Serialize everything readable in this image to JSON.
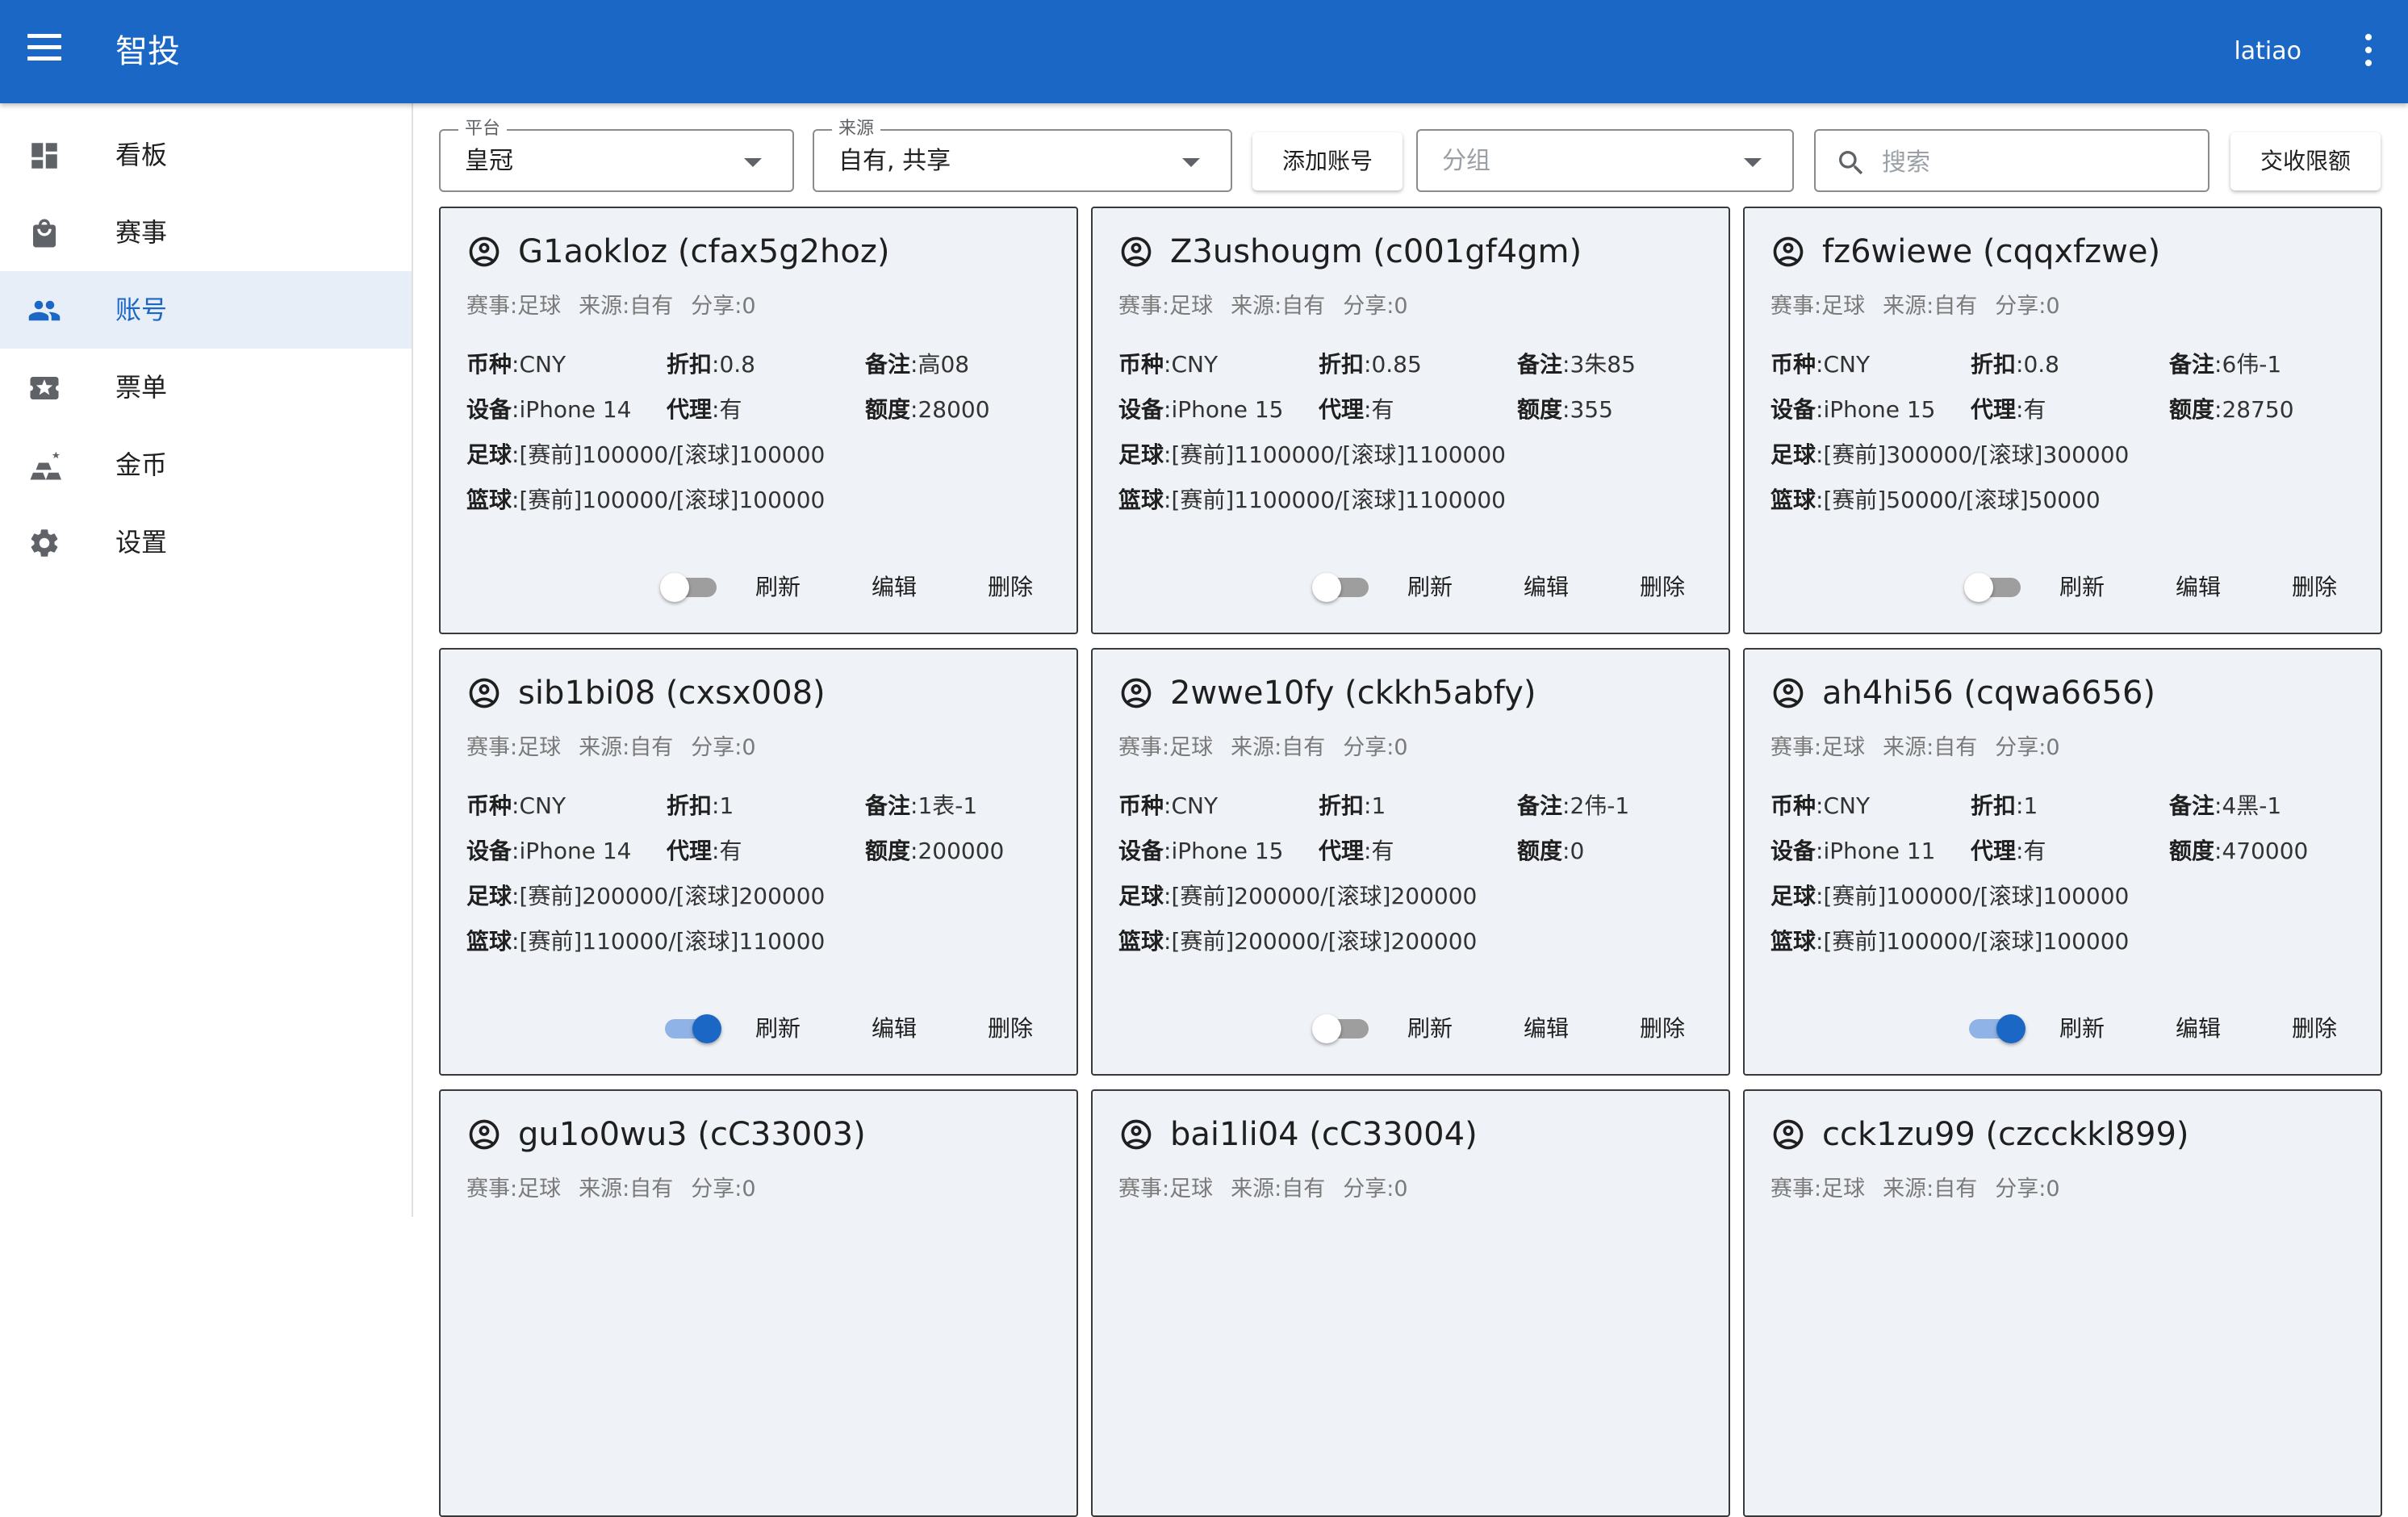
{
  "app": {
    "title": "智投",
    "user": "latiao"
  },
  "sidebar": {
    "items": [
      {
        "label": "看板",
        "icon": "dashboard-icon"
      },
      {
        "label": "赛事",
        "icon": "shopping-bag-icon"
      },
      {
        "label": "账号",
        "icon": "people-icon",
        "active": true
      },
      {
        "label": "票单",
        "icon": "ticket-icon"
      },
      {
        "label": "金币",
        "icon": "gold-bars-icon"
      },
      {
        "label": "设置",
        "icon": "gear-icon"
      }
    ]
  },
  "filters": {
    "platform": {
      "label": "平台",
      "value": "皇冠"
    },
    "source": {
      "label": "来源",
      "value": "自有, 共享"
    },
    "add_button": "添加账号",
    "group": {
      "placeholder": "分组"
    },
    "search": {
      "placeholder": "搜索"
    },
    "limit_button": "交收限额"
  },
  "labels": {
    "match": "赛事",
    "source": "来源",
    "share": "分享",
    "currency": "币种",
    "discount": "折扣",
    "note": "备注",
    "device": "设备",
    "proxy": "代理",
    "amount": "额度",
    "football": "足球",
    "basketball": "篮球",
    "refresh": "刷新",
    "edit": "编辑",
    "delete": "删除"
  },
  "accounts": [
    {
      "title": "G1aokloz (cfax5g2hoz)",
      "match": "足球",
      "source": "自有",
      "share": "0",
      "currency": "CNY",
      "discount": "0.8",
      "note": "高08",
      "device": "iPhone 14",
      "proxy": "有",
      "amount": "28000",
      "football": "[赛前]100000/[滚球]100000",
      "basketball": "[赛前]100000/[滚球]100000",
      "enabled": false
    },
    {
      "title": "Z3ushougm (c001gf4gm)",
      "match": "足球",
      "source": "自有",
      "share": "0",
      "currency": "CNY",
      "discount": "0.85",
      "note": "3朱85",
      "device": "iPhone 15",
      "proxy": "有",
      "amount": "355",
      "football": "[赛前]1100000/[滚球]1100000",
      "basketball": "[赛前]1100000/[滚球]1100000",
      "enabled": false
    },
    {
      "title": "fz6wiewe (cqqxfzwe)",
      "match": "足球",
      "source": "自有",
      "share": "0",
      "currency": "CNY",
      "discount": "0.8",
      "note": "6伟-1",
      "device": "iPhone 15",
      "proxy": "有",
      "amount": "28750",
      "football": "[赛前]300000/[滚球]300000",
      "basketball": "[赛前]50000/[滚球]50000",
      "enabled": false
    },
    {
      "title": "sib1bi08 (cxsx008)",
      "match": "足球",
      "source": "自有",
      "share": "0",
      "currency": "CNY",
      "discount": "1",
      "note": "1表-1",
      "device": "iPhone 14",
      "proxy": "有",
      "amount": "200000",
      "football": "[赛前]200000/[滚球]200000",
      "basketball": "[赛前]110000/[滚球]110000",
      "enabled": true
    },
    {
      "title": "2wwe10fy (ckkh5abfy)",
      "match": "足球",
      "source": "自有",
      "share": "0",
      "currency": "CNY",
      "discount": "1",
      "note": "2伟-1",
      "device": "iPhone 15",
      "proxy": "有",
      "amount": "0",
      "football": "[赛前]200000/[滚球]200000",
      "basketball": "[赛前]200000/[滚球]200000",
      "enabled": false
    },
    {
      "title": "ah4hi56 (cqwa6656)",
      "match": "足球",
      "source": "自有",
      "share": "0",
      "currency": "CNY",
      "discount": "1",
      "note": "4黑-1",
      "device": "iPhone 11",
      "proxy": "有",
      "amount": "470000",
      "football": "[赛前]100000/[滚球]100000",
      "basketball": "[赛前]100000/[滚球]100000",
      "enabled": true
    },
    {
      "title": "gu1o0wu3 (cC33003)",
      "match": "足球",
      "source": "自有",
      "share": "0"
    },
    {
      "title": "bai1li04 (cC33004)",
      "match": "足球",
      "source": "自有",
      "share": "0"
    },
    {
      "title": "cck1zu99 (czcckkl899)",
      "match": "足球",
      "source": "自有",
      "share": "0"
    }
  ],
  "colors": {
    "primary": "#1a67c6",
    "card_bg": "#eff2f6",
    "active_nav_bg": "#e8eef7"
  }
}
